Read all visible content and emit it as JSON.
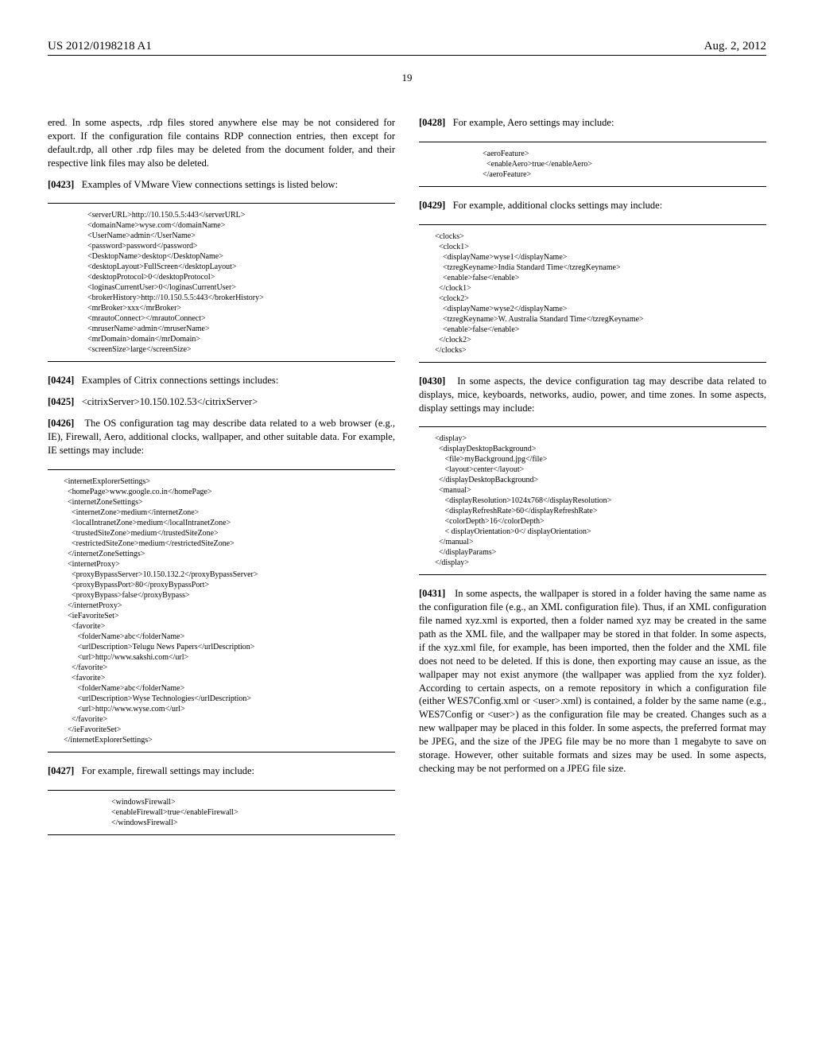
{
  "header": {
    "pub_number": "US 2012/0198218 A1",
    "date": "Aug. 2, 2012",
    "page_number": "19"
  },
  "col1": {
    "p422_cont": "ered. In some aspects, .rdp files stored anywhere else may be not considered for export. If the configuration file contains RDP connection entries, then except for default.rdp, all other .rdp files may be deleted from the document folder, and their respective link files may also be deleted.",
    "p423_num": "[0423]",
    "p423": "Examples of VMware View connections settings is listed below:",
    "code1": "<serverURL>http://10.150.5.5:443</serverURL>\n<domainName>wyse.com</domainName>\n<UserName>admin</UserName>\n<password>password</password>\n<DesktopName>desktop</DesktopName>\n<desktopLayout>FullScreen</desktopLayout>\n<desktopProtocol>0</desktopProtocol>\n<loginasCurrentUser>0</loginasCurrentUser>\n<brokerHistory>http://10.150.5.5:443</brokerHistory>\n<mrBroker>xxx</mrBroker>\n<mrautoConnect></mrautoConnect>\n<mruserName>admin</mruserName>\n<mrDomain>domain</mrDomain>\n<screenSize>large</screenSize>",
    "p424_num": "[0424]",
    "p424": "Examples of Citrix connections settings includes:",
    "p425_num": "[0425]",
    "p425": "<citrixServer>10.150.102.53</citrixServer>",
    "p426_num": "[0426]",
    "p426": "The OS configuration tag may describe data related to a web browser (e.g., IE), Firewall, Aero, additional clocks, wallpaper, and other suitable data. For example, IE settings may include:",
    "code2": "<internetExplorerSettings>\n  <homePage>www.google.co.in</homePage>\n  <internetZoneSettings>\n    <internetZone>medium</internetZone>\n    <localIntranetZone>medium</localIntranetZone>\n    <trustedSiteZone>medium</trustedSiteZone>\n    <restrictedSiteZone>medium</restrictedSiteZone>\n  </internetZoneSettings>\n  <internetProxy>\n    <proxyBypassServer>10.150.132.2</proxyBypassServer>\n    <proxyBypassPort>80</proxyBypassPort>\n    <proxyBypass>false</proxyBypass>\n  </internetProxy>\n  <ieFavoriteSet>\n    <favorite>\n       <folderName>abc</folderName>\n       <urlDescription>Telugu News Papers</urlDescription>\n       <url>http://www.sakshi.com</url>\n    </favorite>\n    <favorite>\n       <folderName>abc</folderName>\n       <urlDescription>Wyse Technologies</urlDescription>\n       <url>http://www.wyse.com</url>\n    </favorite>\n  </ieFavoriteSet>\n</internetExplorerSettings>",
    "p427_num": "[0427]",
    "p427": "For example, firewall settings may include:",
    "code3": "<windowsFirewall>\n<enableFirewall>true</enableFirewall>\n</windowsFirewall>"
  },
  "col2": {
    "p428_num": "[0428]",
    "p428": "For example, Aero settings may include:",
    "code4": "<aeroFeature>\n  <enableAero>true</enableAero>\n</aeroFeature>",
    "p429_num": "[0429]",
    "p429": "For example, additional clocks settings may include:",
    "code5": "<clocks>\n  <clock1>\n    <displayName>wyse1</displayName>\n    <tzregKeyname>India Standard Time</tzregKeyname>\n    <enable>false</enable>\n  </clock1>\n  <clock2>\n    <displayName>wyse2</displayName>\n    <tzregKeyname>W. Australia Standard Time</tzregKeyname>\n    <enable>false</enable>\n  </clock2>\n</clocks>",
    "p430_num": "[0430]",
    "p430": "In some aspects, the device configuration tag may describe data related to displays, mice, keyboards, networks, audio, power, and time zones. In some aspects, display settings may include:",
    "code6": "<display>\n  <displayDesktopBackground>\n     <file>myBackground.jpg</file>\n     <layout>center</layout>\n  </displayDesktopBackground>\n  <manual>\n     <displayResolution>1024x768</displayResolution>\n     <displayRefreshRate>60</displayRefreshRate>\n     <colorDepth>16</colorDepth>\n     < displayOrientation>0</ displayOrientation>\n  </manual>\n  </displayParams>\n</display>",
    "p431_num": "[0431]",
    "p431": "In some aspects, the wallpaper is stored in a folder having the same name as the configuration file (e.g., an XML configuration file). Thus, if an XML configuration file named xyz.xml is exported, then a folder named xyz may be created in the same path as the XML file, and the wallpaper may be stored in that folder. In some aspects, if the xyz.xml file, for example, has been imported, then the folder and the XML file does not need to be deleted. If this is done, then exporting may cause an issue, as the wallpaper may not exist anymore (the wallpaper was applied from the xyz folder). According to certain aspects, on a remote repository in which a configuration file (either WES7Config.xml or <user>.xml) is contained, a folder by the same name (e.g., WES7Config or <user>) as the configuration file may be created. Changes such as a new wallpaper may be placed in this folder. In some aspects, the preferred format may be JPEG, and the size of the JPEG file may be no more than 1 megabyte to save on storage. However, other suitable formats and sizes may be used. In some aspects, checking may be not performed on a JPEG file size."
  }
}
